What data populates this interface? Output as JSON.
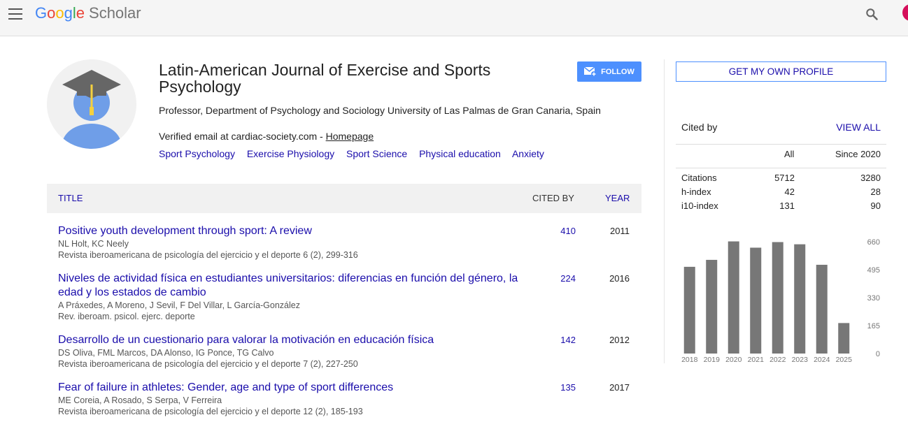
{
  "header": {
    "logo_google": [
      "G",
      "o",
      "o",
      "g",
      "l",
      "e"
    ],
    "logo_product": "Scholar"
  },
  "profile": {
    "name": "Latin-American Journal of Exercise and Sports Psychology",
    "affiliation": "Professor, Department of Psychology and Sociology University of Las Palmas de Gran Canaria, Spain",
    "email_text": "Verified email at cardiac-society.com - ",
    "homepage_label": "Homepage",
    "interests": [
      "Sport Psychology",
      "Exercise Physiology",
      "Sport Science",
      "Physical education",
      "Anxiety"
    ],
    "follow_label": "FOLLOW"
  },
  "table": {
    "col_title": "TITLE",
    "col_cited": "CITED BY",
    "col_year": "YEAR",
    "rows": [
      {
        "title": "Positive youth development through sport: A review",
        "authors": "NL Holt, KC Neely",
        "venue": "Revista iberoamericana de psicología del ejercicio y el deporte 6 (2), 299-316",
        "cited": "410",
        "year": "2011"
      },
      {
        "title": "Niveles de actividad física en estudiantes universitarios: diferencias en función del género, la edad y los estados de cambio",
        "authors": "A Práxedes, A Moreno, J Sevil, F Del Villar, L García-González",
        "venue": "Rev. iberoam. psicol. ejerc. deporte",
        "cited": "224",
        "year": "2016"
      },
      {
        "title": "Desarrollo de un cuestionario para valorar la motivación en educación física",
        "authors": "DS Oliva, FML Marcos, DA Alonso, IG Ponce, TG Calvo",
        "venue": "Revista iberoamericana de psicología del ejercicio y el deporte 7 (2), 227-250",
        "cited": "142",
        "year": "2012"
      },
      {
        "title": "Fear of failure in athletes: Gender, age and type of sport differences",
        "authors": "ME Coreia, A Rosado, S Serpa, V Ferreira",
        "venue": "Revista iberoamericana de psicología del ejercicio y el deporte 12 (2), 185-193",
        "cited": "135",
        "year": "2017"
      }
    ]
  },
  "sidebar": {
    "get_profile_label": "GET MY OWN PROFILE",
    "cited_by_label": "Cited by",
    "view_all_label": "VIEW ALL",
    "col_all": "All",
    "col_since": "Since 2020",
    "stats": [
      {
        "label": "Citations",
        "all": "5712",
        "since": "3280"
      },
      {
        "label": "h-index",
        "all": "42",
        "since": "28"
      },
      {
        "label": "i10-index",
        "all": "131",
        "since": "90"
      }
    ]
  },
  "chart_data": {
    "type": "bar",
    "categories": [
      "2018",
      "2019",
      "2020",
      "2021",
      "2022",
      "2023",
      "2024",
      "2025"
    ],
    "values": [
      512,
      553,
      662,
      625,
      658,
      645,
      524,
      180
    ],
    "yticks": [
      0,
      165,
      330,
      495,
      660
    ],
    "ylim": [
      0,
      660
    ],
    "bar_color": "#777777"
  },
  "colors": {
    "link": "#1a0dab",
    "follow_bg": "#4d90fe",
    "avatar_top": "#d50f5b"
  }
}
